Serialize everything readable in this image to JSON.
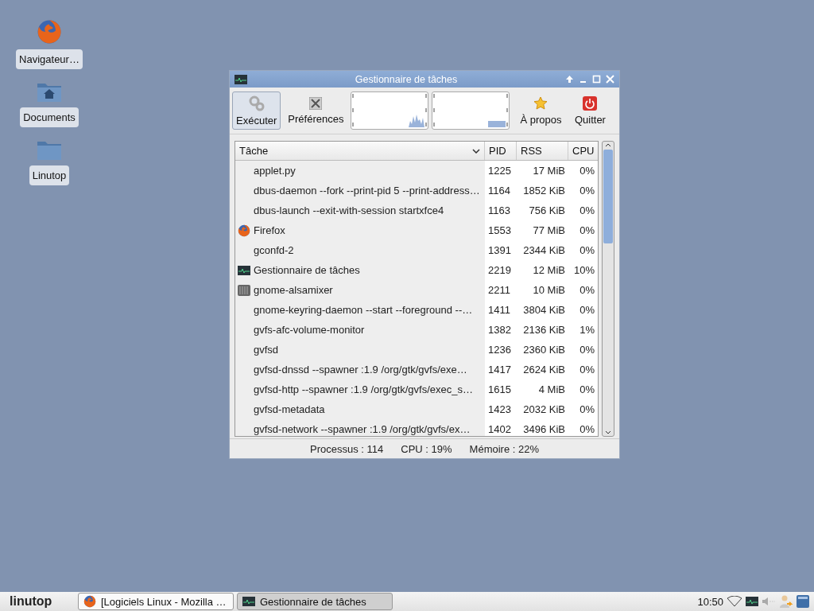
{
  "desktop_icons": [
    {
      "kind": "browser",
      "label": "Navigateur…"
    },
    {
      "kind": "home",
      "label": "Documents"
    },
    {
      "kind": "folder",
      "label": "Linutop"
    }
  ],
  "window": {
    "title": "Gestionnaire de tâches",
    "toolbar": [
      {
        "kind": "run",
        "label": "Exécuter",
        "selected": true
      },
      {
        "kind": "prefs",
        "label": "Préférences",
        "selected": false
      },
      {
        "kind": "cpu-graph"
      },
      {
        "kind": "mem-graph"
      },
      {
        "kind": "about",
        "label": "À propos",
        "selected": false
      },
      {
        "kind": "quit",
        "label": "Quitter",
        "selected": false
      }
    ],
    "table": {
      "columns": [
        "Tâche",
        "PID",
        "RSS",
        "CPU"
      ],
      "rows": [
        {
          "kind": "plain",
          "name": "applet.py",
          "pid": "1225",
          "rss": "17 MiB",
          "cpu": "0%"
        },
        {
          "kind": "plain",
          "name": "dbus-daemon --fork --print-pid 5 --print-address…",
          "pid": "1164",
          "rss": "1852 KiB",
          "cpu": "0%"
        },
        {
          "kind": "plain",
          "name": "dbus-launch --exit-with-session startxfce4",
          "pid": "1163",
          "rss": "756 KiB",
          "cpu": "0%"
        },
        {
          "kind": "browser",
          "name": "Firefox",
          "pid": "1553",
          "rss": "77 MiB",
          "cpu": "0%"
        },
        {
          "kind": "plain",
          "name": "gconfd-2",
          "pid": "1391",
          "rss": "2344 KiB",
          "cpu": "0%"
        },
        {
          "kind": "monitor",
          "name": "Gestionnaire de tâches",
          "pid": "2219",
          "rss": "12 MiB",
          "cpu": "10%"
        },
        {
          "kind": "mixer",
          "name": "gnome-alsamixer",
          "pid": "2211",
          "rss": "10 MiB",
          "cpu": "0%"
        },
        {
          "kind": "plain",
          "name": "gnome-keyring-daemon --start --foreground --…",
          "pid": "1411",
          "rss": "3804 KiB",
          "cpu": "0%"
        },
        {
          "kind": "plain",
          "name": "gvfs-afc-volume-monitor",
          "pid": "1382",
          "rss": "2136 KiB",
          "cpu": "1%"
        },
        {
          "kind": "plain",
          "name": "gvfsd",
          "pid": "1236",
          "rss": "2360 KiB",
          "cpu": "0%"
        },
        {
          "kind": "plain",
          "name": "gvfsd-dnssd --spawner :1.9 /org/gtk/gvfs/exe…",
          "pid": "1417",
          "rss": "2624 KiB",
          "cpu": "0%"
        },
        {
          "kind": "plain",
          "name": "gvfsd-http --spawner :1.9 /org/gtk/gvfs/exec_s…",
          "pid": "1615",
          "rss": "4 MiB",
          "cpu": "0%"
        },
        {
          "kind": "plain",
          "name": "gvfsd-metadata",
          "pid": "1423",
          "rss": "2032 KiB",
          "cpu": "0%"
        },
        {
          "kind": "plain",
          "name": "gvfsd-network --spawner :1.9 /org/gtk/gvfs/ex…",
          "pid": "1402",
          "rss": "3496 KiB",
          "cpu": "0%"
        }
      ]
    },
    "status_bar": [
      "Processus : 114",
      "CPU : 19%",
      "Mémoire : 22%"
    ]
  },
  "taskbar": {
    "logo": "linutop",
    "tasks": [
      {
        "kind": "browser",
        "label": "[Logiciels Linux - Mozilla …",
        "selected": false
      },
      {
        "kind": "monitor",
        "label": "Gestionnaire de tâches",
        "selected": true
      }
    ],
    "clock": "10:50"
  }
}
